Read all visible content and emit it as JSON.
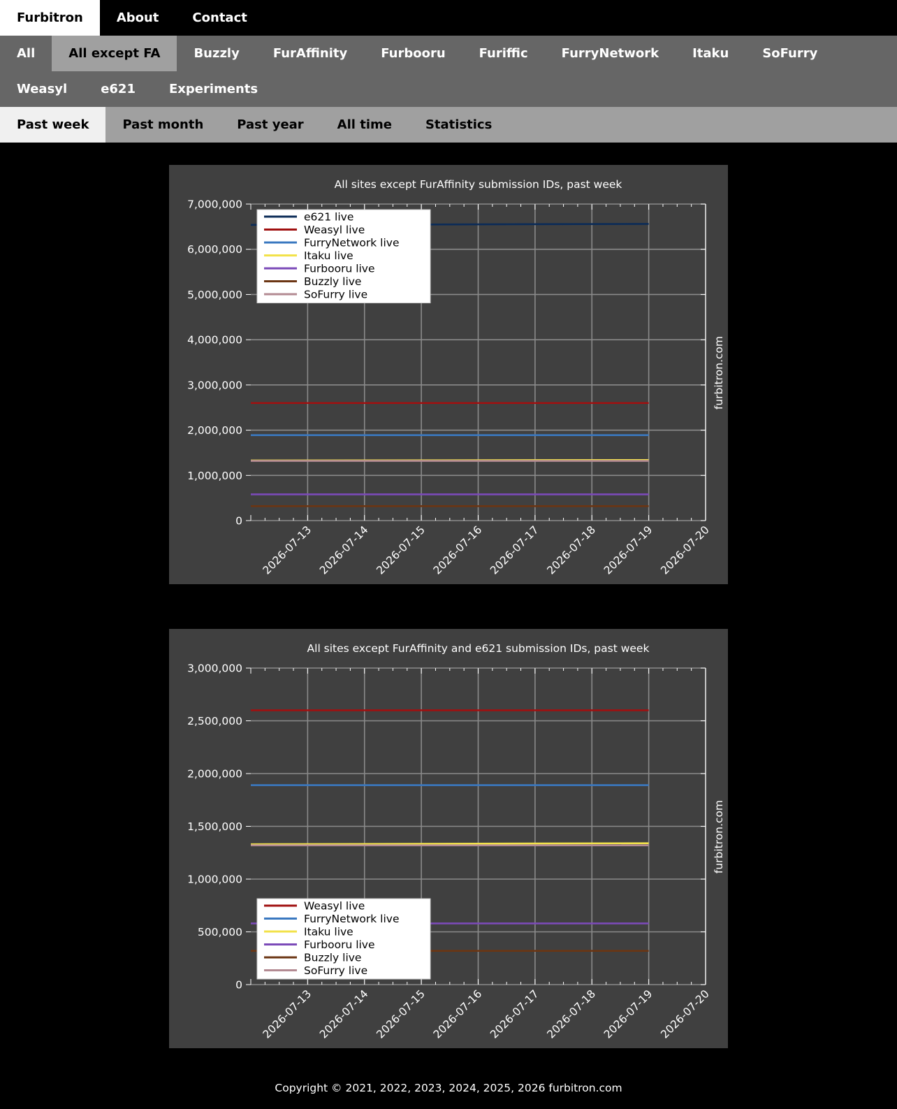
{
  "nav_main": [
    {
      "label": "Furbitron",
      "active": true
    },
    {
      "label": "About",
      "active": false
    },
    {
      "label": "Contact",
      "active": false
    }
  ],
  "nav_sites": [
    {
      "label": "All",
      "active": false
    },
    {
      "label": "All except FA",
      "active": true
    },
    {
      "label": "Buzzly",
      "active": false
    },
    {
      "label": "FurAffinity",
      "active": false
    },
    {
      "label": "Furbooru",
      "active": false
    },
    {
      "label": "Furiffic",
      "active": false
    },
    {
      "label": "FurryNetwork",
      "active": false
    },
    {
      "label": "Itaku",
      "active": false
    },
    {
      "label": "SoFurry",
      "active": false
    },
    {
      "label": "Weasyl",
      "active": false
    },
    {
      "label": "e621",
      "active": false
    },
    {
      "label": "Experiments",
      "active": false
    }
  ],
  "nav_period": [
    {
      "label": "Past week",
      "active": true
    },
    {
      "label": "Past month",
      "active": false
    },
    {
      "label": "Past year",
      "active": false
    },
    {
      "label": "All time",
      "active": false
    },
    {
      "label": "Statistics",
      "active": false
    }
  ],
  "colors": {
    "e621": "#0b2b57",
    "Weasyl": "#a01010",
    "FurryNetwork": "#3a78c0",
    "Itaku": "#f2e24a",
    "Furbooru": "#7b4ab8",
    "Buzzly": "#6b3513",
    "SoFurry": "#b38a92",
    "plot_bg": "#404040"
  },
  "watermark": "furbitron.com",
  "chart_data": [
    {
      "type": "line",
      "title": "All sites except FurAffinity submission IDs, past week",
      "xlabel": "",
      "ylabel": "",
      "ylim": [
        0,
        7000000
      ],
      "yticks": [
        0,
        1000000,
        2000000,
        3000000,
        4000000,
        5000000,
        6000000,
        7000000
      ],
      "ytick_labels": [
        "0",
        "1,000,000",
        "2,000,000",
        "3,000,000",
        "4,000,000",
        "5,000,000",
        "6,000,000",
        "7,000,000"
      ],
      "xlim": [
        "2026-07-12",
        "2026-07-20"
      ],
      "xticks": [
        "2026-07-13",
        "2026-07-14",
        "2026-07-15",
        "2026-07-16",
        "2026-07-17",
        "2026-07-18",
        "2026-07-19",
        "2026-07-20"
      ],
      "grid": true,
      "legend_position": "upper-left",
      "series": [
        {
          "name": "e621 live",
          "x": [
            "2026-07-12",
            "2026-07-19"
          ],
          "values": [
            6540000,
            6560000
          ]
        },
        {
          "name": "Weasyl live",
          "x": [
            "2026-07-12",
            "2026-07-19"
          ],
          "values": [
            2600000,
            2600000
          ]
        },
        {
          "name": "FurryNetwork live",
          "x": [
            "2026-07-12",
            "2026-07-19"
          ],
          "values": [
            1890000,
            1890000
          ]
        },
        {
          "name": "Itaku live",
          "x": [
            "2026-07-12",
            "2026-07-19"
          ],
          "values": [
            1330000,
            1340000
          ]
        },
        {
          "name": "Furbooru live",
          "x": [
            "2026-07-12",
            "2026-07-19"
          ],
          "values": [
            580000,
            580000
          ]
        },
        {
          "name": "Buzzly live",
          "x": [
            "2026-07-12",
            "2026-07-19"
          ],
          "values": [
            320000,
            320000
          ]
        },
        {
          "name": "SoFurry live",
          "x": [
            "2026-07-12",
            "2026-07-19"
          ],
          "values": [
            1320000,
            1320000
          ]
        }
      ]
    },
    {
      "type": "line",
      "title": "All sites except FurAffinity and e621 submission IDs, past week",
      "xlabel": "",
      "ylabel": "",
      "ylim": [
        0,
        3000000
      ],
      "yticks": [
        0,
        500000,
        1000000,
        1500000,
        2000000,
        2500000,
        3000000
      ],
      "ytick_labels": [
        "0",
        "500,000",
        "1,000,000",
        "1,500,000",
        "2,000,000",
        "2,500,000",
        "3,000,000"
      ],
      "xlim": [
        "2026-07-12",
        "2026-07-20"
      ],
      "xticks": [
        "2026-07-13",
        "2026-07-14",
        "2026-07-15",
        "2026-07-16",
        "2026-07-17",
        "2026-07-18",
        "2026-07-19",
        "2026-07-20"
      ],
      "grid": true,
      "legend_position": "lower-left",
      "series": [
        {
          "name": "Weasyl live",
          "x": [
            "2026-07-12",
            "2026-07-19"
          ],
          "values": [
            2600000,
            2600000
          ]
        },
        {
          "name": "FurryNetwork live",
          "x": [
            "2026-07-12",
            "2026-07-19"
          ],
          "values": [
            1890000,
            1890000
          ]
        },
        {
          "name": "Itaku live",
          "x": [
            "2026-07-12",
            "2026-07-19"
          ],
          "values": [
            1330000,
            1340000
          ]
        },
        {
          "name": "Furbooru live",
          "x": [
            "2026-07-12",
            "2026-07-19"
          ],
          "values": [
            580000,
            580000
          ]
        },
        {
          "name": "Buzzly live",
          "x": [
            "2026-07-12",
            "2026-07-19"
          ],
          "values": [
            320000,
            320000
          ]
        },
        {
          "name": "SoFurry live",
          "x": [
            "2026-07-12",
            "2026-07-19"
          ],
          "values": [
            1320000,
            1320000
          ]
        }
      ]
    }
  ],
  "footer": "Copyright © 2021, 2022, 2023, 2024, 2025, 2026 furbitron.com"
}
